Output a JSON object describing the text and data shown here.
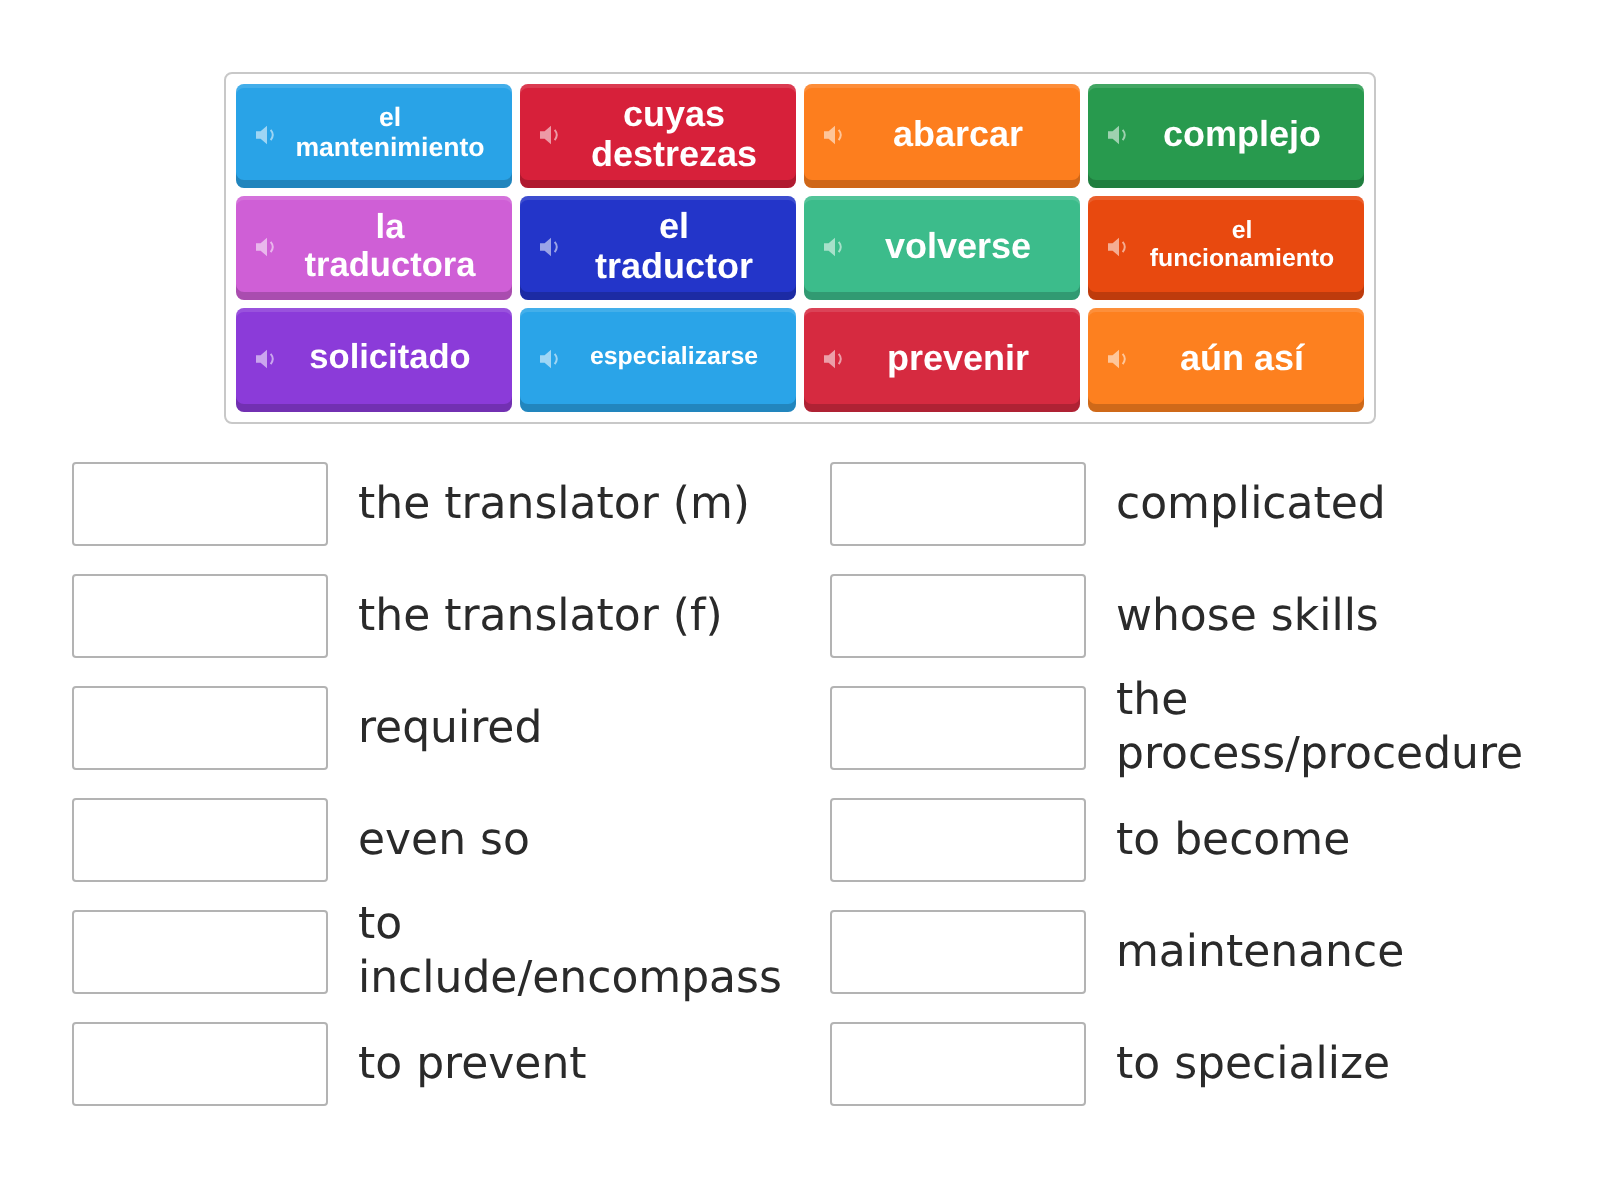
{
  "tiles": [
    {
      "text": "el mantenimiento",
      "color": "#29a3e7"
    },
    {
      "text": "cuyas destrezas",
      "color": "#d7203a"
    },
    {
      "text": "abarcar",
      "color": "#fd7e1e"
    },
    {
      "text": "complejo",
      "color": "#289a4e"
    },
    {
      "text": "la traductora",
      "color": "#cf5fd6"
    },
    {
      "text": "el traductor",
      "color": "#2335c9"
    },
    {
      "text": "volverse",
      "color": "#3cbc8b"
    },
    {
      "text": "el funcionamiento",
      "color": "#e8490f"
    },
    {
      "text": "solicitado",
      "color": "#8b3bd9"
    },
    {
      "text": "especializarse",
      "color": "#2aa4e8"
    },
    {
      "text": "prevenir",
      "color": "#d62a40"
    },
    {
      "text": "aún así",
      "color": "#fd801f"
    }
  ],
  "clues": [
    {
      "text": "the translator (m)"
    },
    {
      "text": "the translator (f)"
    },
    {
      "text": "required"
    },
    {
      "text": "even so"
    },
    {
      "text": "to include/encompass"
    },
    {
      "text": "to prevent"
    },
    {
      "text": "complicated"
    },
    {
      "text": "whose skills"
    },
    {
      "text": "the process/procedure"
    },
    {
      "text": "to become"
    },
    {
      "text": "maintenance"
    },
    {
      "text": "to specialize"
    }
  ]
}
